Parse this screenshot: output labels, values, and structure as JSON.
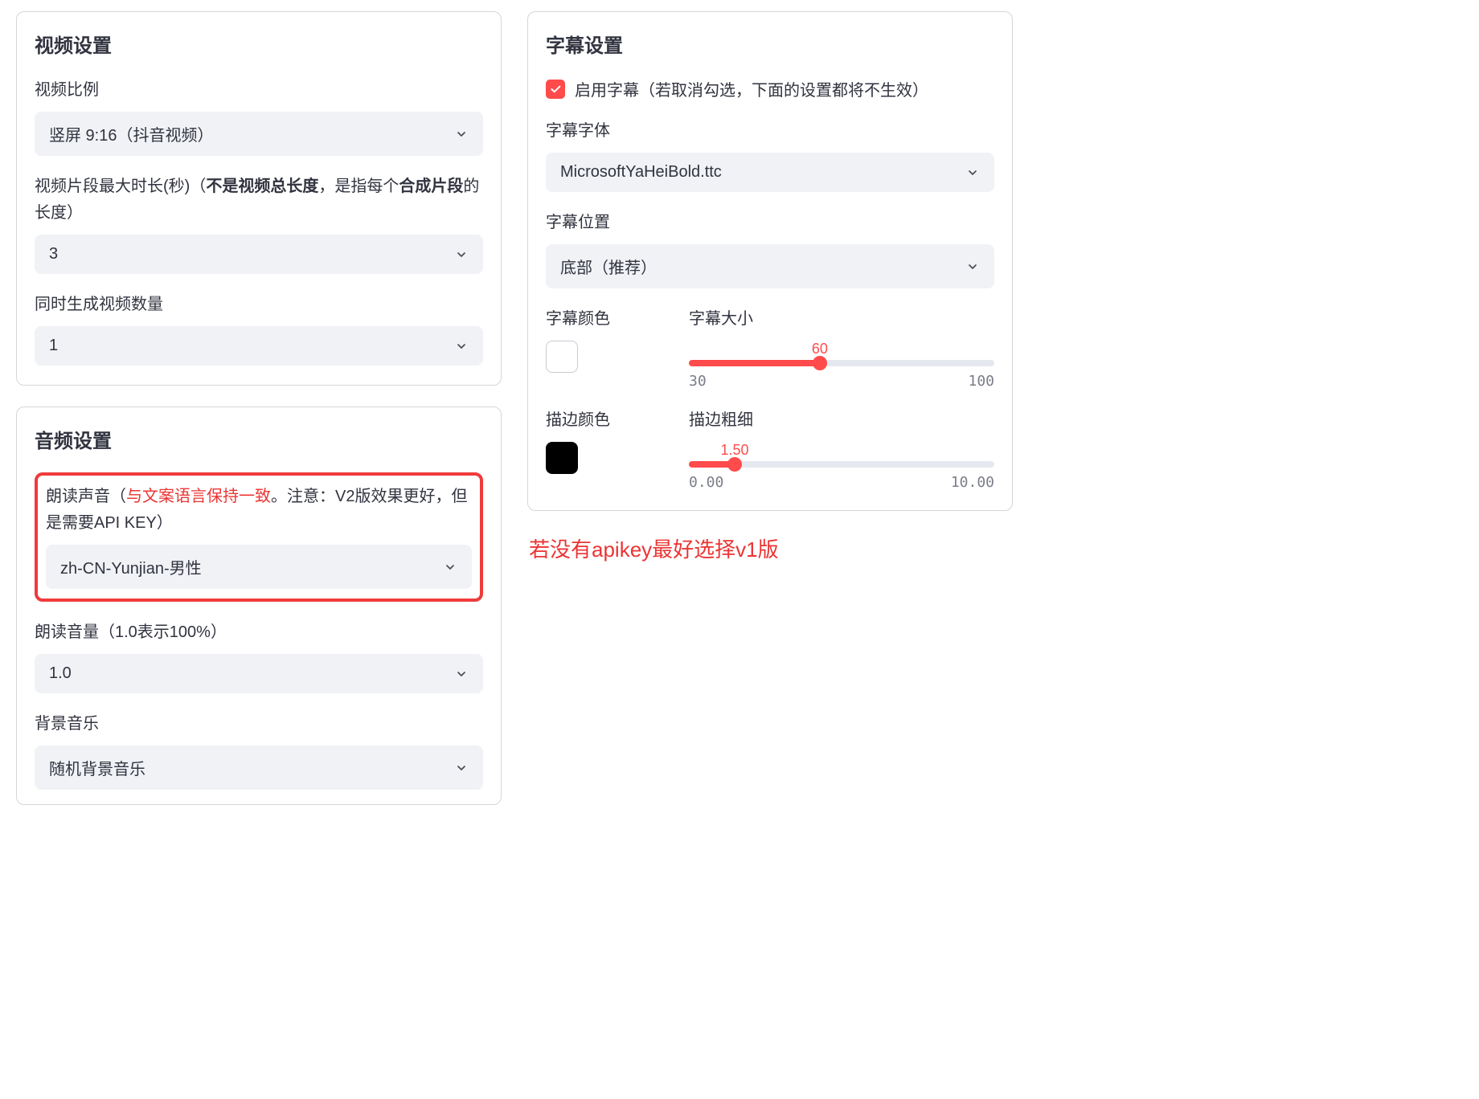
{
  "video": {
    "title": "视频设置",
    "aspect": {
      "label": "视频比例",
      "value": "竖屏 9:16（抖音视频）"
    },
    "clip_duration": {
      "label_pre": "视频片段最大时长(秒)（",
      "label_bold1": "不是视频总长度",
      "label_mid": "，是指每个",
      "label_bold2": "合成片段",
      "label_post": "的长度）",
      "value": "3"
    },
    "concurrent": {
      "label": "同时生成视频数量",
      "value": "1"
    }
  },
  "audio": {
    "title": "音频设置",
    "voice": {
      "label_pre": "朗读声音（",
      "label_red": "与文案语言保持一致",
      "label_post": "。注意：V2版效果更好，但是需要API KEY）",
      "value": "zh-CN-Yunjian-男性"
    },
    "volume": {
      "label": "朗读音量（1.0表示100%）",
      "value": "1.0"
    },
    "bgm": {
      "label": "背景音乐",
      "value": "随机背景音乐"
    }
  },
  "subtitle": {
    "title": "字幕设置",
    "enable_label": "启用字幕（若取消勾选，下面的设置都将不生效）",
    "enable_checked": true,
    "font": {
      "label": "字幕字体",
      "value": "MicrosoftYaHeiBold.ttc"
    },
    "position": {
      "label": "字幕位置",
      "value": "底部（推荐）"
    },
    "color": {
      "label": "字幕颜色",
      "value": "#FFFFFF"
    },
    "size": {
      "label": "字幕大小",
      "value": "60",
      "min": "30",
      "max": "100",
      "pct": 42.857
    },
    "stroke_color": {
      "label": "描边颜色",
      "value": "#000000"
    },
    "stroke_width": {
      "label": "描边粗细",
      "value": "1.50",
      "min": "0.00",
      "max": "10.00",
      "pct": 15
    }
  },
  "external_note": "若没有apikey最好选择v1版"
}
